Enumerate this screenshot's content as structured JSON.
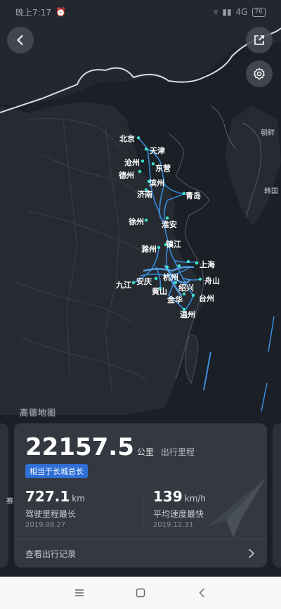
{
  "status_bar": {
    "time": "晚上7:17",
    "network": "4G",
    "battery": "76"
  },
  "map": {
    "watermark": "高德地图",
    "cities": [
      {
        "name": "北京",
        "label": "北京"
      },
      {
        "name": "天津",
        "label": "天津"
      },
      {
        "name": "沧州",
        "label": "沧州"
      },
      {
        "name": "东营",
        "label": "东营"
      },
      {
        "name": "德州",
        "label": "德州"
      },
      {
        "name": "滨州",
        "label": "滨州"
      },
      {
        "name": "济南",
        "label": "济南"
      },
      {
        "name": "青岛",
        "label": "青岛"
      },
      {
        "name": "徐州",
        "label": "徐州"
      },
      {
        "name": "淮安",
        "label": "淮安"
      },
      {
        "name": "镇江",
        "label": "镇江"
      },
      {
        "name": "滁州",
        "label": "滁州"
      },
      {
        "name": "上海",
        "label": "上海"
      },
      {
        "name": "杭州",
        "label": "杭州"
      },
      {
        "name": "安庆",
        "label": "安庆"
      },
      {
        "name": "九江",
        "label": "九江"
      },
      {
        "name": "舟山",
        "label": "舟山"
      },
      {
        "name": "绍兴",
        "label": "绍兴"
      },
      {
        "name": "黄山",
        "label": "黄山"
      },
      {
        "name": "金华",
        "label": "金华"
      },
      {
        "name": "台州",
        "label": "台州"
      },
      {
        "name": "温州",
        "label": "温州"
      }
    ],
    "foreign": {
      "korea_north": "朝鲜",
      "korea_south": "韩国"
    }
  },
  "card": {
    "total_distance": "22157.5",
    "total_unit": "公里",
    "total_label": "出行里程",
    "badge": "相当于长城总长",
    "stat1": {
      "value": "727.1",
      "unit": "km",
      "label": "驾驶里程最长",
      "date": "2019.08.27"
    },
    "stat2": {
      "value": "139",
      "unit": "km/h",
      "label": "平均速度最快",
      "date": "2019.12.31"
    },
    "footer": "查看出行记录"
  },
  "side_card_text": "赛",
  "colors": {
    "background": "#1b1f26",
    "route": "#3a8fe0",
    "badge": "#2f6fd6"
  }
}
